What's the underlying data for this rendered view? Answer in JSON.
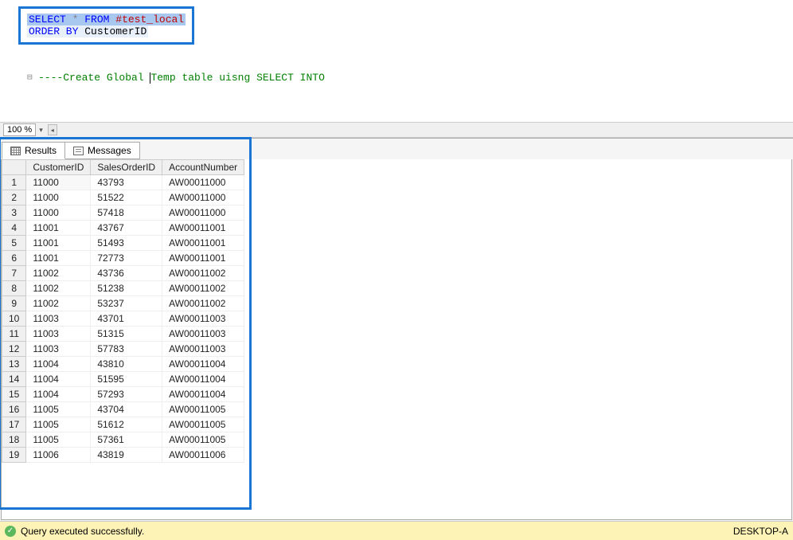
{
  "editor": {
    "line1": {
      "select": "SELECT",
      "star": "*",
      "from": "FROM",
      "table": "#test_local"
    },
    "line2": {
      "orderby": "ORDER BY",
      "col": "CustomerID"
    },
    "comment": {
      "dashes": "----",
      "text1": "Create Global ",
      "text2": "Temp table uisng ",
      "text3": "SELECT INTO"
    }
  },
  "zoom": "100 %",
  "tabs": {
    "results": "Results",
    "messages": "Messages"
  },
  "grid": {
    "headers": [
      "CustomerID",
      "SalesOrderID",
      "AccountNumber"
    ],
    "rows": [
      {
        "n": "1",
        "c": [
          "11000",
          "43793",
          "AW00011000"
        ]
      },
      {
        "n": "2",
        "c": [
          "11000",
          "51522",
          "AW00011000"
        ]
      },
      {
        "n": "3",
        "c": [
          "11000",
          "57418",
          "AW00011000"
        ]
      },
      {
        "n": "4",
        "c": [
          "11001",
          "43767",
          "AW00011001"
        ]
      },
      {
        "n": "5",
        "c": [
          "11001",
          "51493",
          "AW00011001"
        ]
      },
      {
        "n": "6",
        "c": [
          "11001",
          "72773",
          "AW00011001"
        ]
      },
      {
        "n": "7",
        "c": [
          "11002",
          "43736",
          "AW00011002"
        ]
      },
      {
        "n": "8",
        "c": [
          "11002",
          "51238",
          "AW00011002"
        ]
      },
      {
        "n": "9",
        "c": [
          "11002",
          "53237",
          "AW00011002"
        ]
      },
      {
        "n": "10",
        "c": [
          "11003",
          "43701",
          "AW00011003"
        ]
      },
      {
        "n": "11",
        "c": [
          "11003",
          "51315",
          "AW00011003"
        ]
      },
      {
        "n": "12",
        "c": [
          "11003",
          "57783",
          "AW00011003"
        ]
      },
      {
        "n": "13",
        "c": [
          "11004",
          "43810",
          "AW00011004"
        ]
      },
      {
        "n": "14",
        "c": [
          "11004",
          "51595",
          "AW00011004"
        ]
      },
      {
        "n": "15",
        "c": [
          "11004",
          "57293",
          "AW00011004"
        ]
      },
      {
        "n": "16",
        "c": [
          "11005",
          "43704",
          "AW00011005"
        ]
      },
      {
        "n": "17",
        "c": [
          "11005",
          "51612",
          "AW00011005"
        ]
      },
      {
        "n": "18",
        "c": [
          "11005",
          "57361",
          "AW00011005"
        ]
      },
      {
        "n": "19",
        "c": [
          "11006",
          "43819",
          "AW00011006"
        ]
      }
    ]
  },
  "status": {
    "msg": "Query executed successfully.",
    "server": "DESKTOP-A"
  }
}
